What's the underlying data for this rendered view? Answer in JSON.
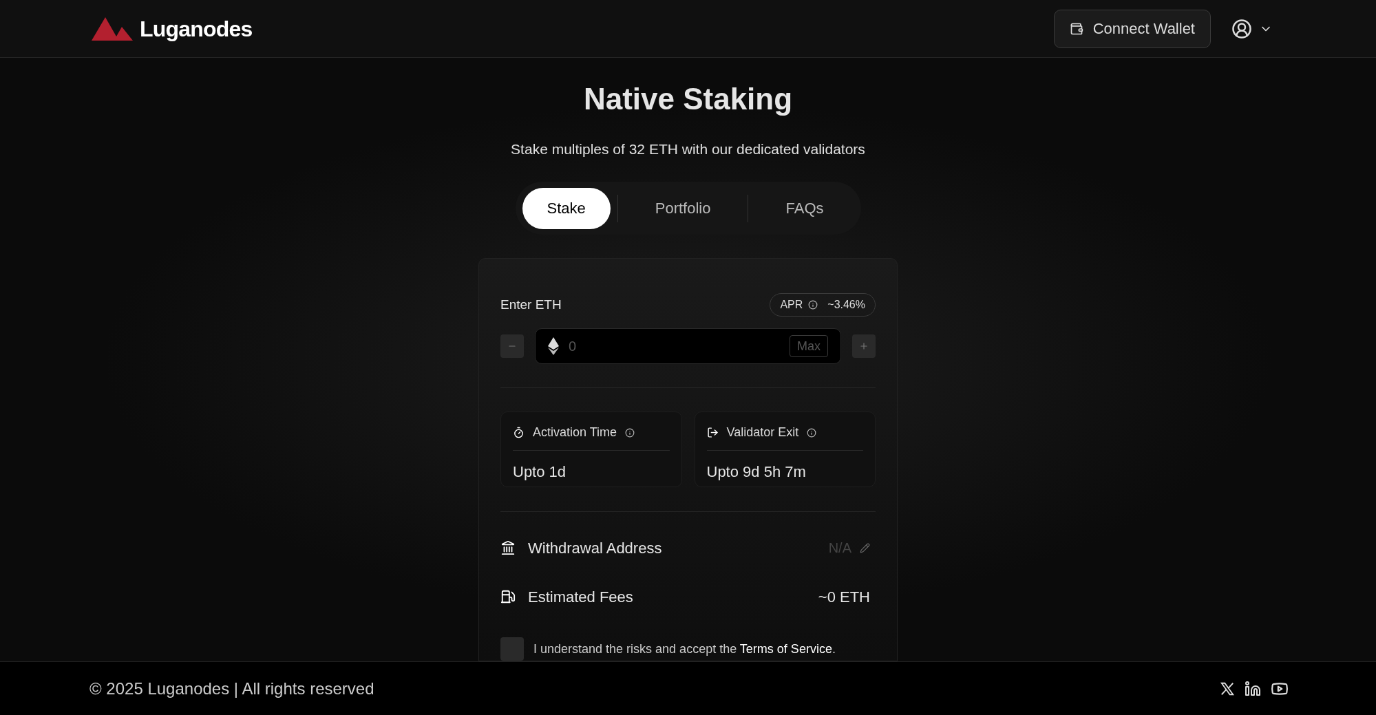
{
  "header": {
    "brand": "Luganodes",
    "connect_button": "Connect Wallet"
  },
  "title": "Native Staking",
  "subtitle": "Stake multiples of 32 ETH with our dedicated validators",
  "tabs": [
    {
      "label": "Stake",
      "selected": true
    },
    {
      "label": "Portfolio",
      "selected": false
    },
    {
      "label": "FAQs",
      "selected": false
    }
  ],
  "stake_card": {
    "label": "Enter ETH",
    "apr_label": "APR",
    "apr_value": "~3.46%",
    "amount_placeholder": "0",
    "max_button": "Max",
    "info": [
      {
        "kind": "timer",
        "title": "Activation Time",
        "value": "Upto 1d"
      },
      {
        "kind": "exit",
        "title": "Validator Exit",
        "value": "Upto 9d 5h 7m"
      }
    ],
    "rows": [
      {
        "kind": "address",
        "label": "Withdrawal Address",
        "value": "N/A",
        "editable": true
      },
      {
        "kind": "fees",
        "label": "Estimated Fees",
        "value": "~0 ETH",
        "editable": false
      }
    ],
    "terms": {
      "checked": false,
      "text": "I understand the risks and accept the ",
      "link": "Terms of Service",
      "end": "."
    }
  },
  "footer": {
    "copyright": "© 2025 Luganodes | All rights reserved"
  }
}
